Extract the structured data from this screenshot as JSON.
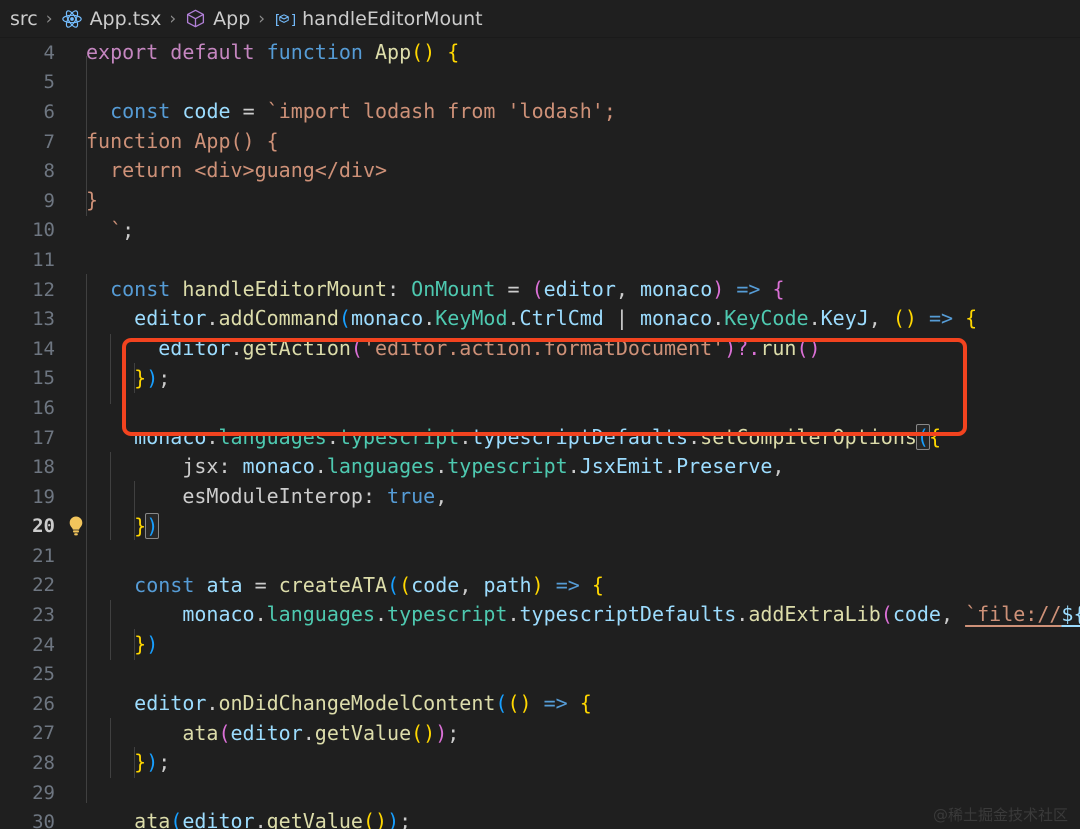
{
  "window": {
    "background": "#1f1f1f",
    "accent_red": "#f2431f"
  },
  "breadcrumb": {
    "items": [
      {
        "label": "src",
        "icon": null
      },
      {
        "label": "App.tsx",
        "icon": "react-atom-icon"
      },
      {
        "label": "App",
        "icon": "symbol-cube-icon"
      },
      {
        "label": "handleEditorMount",
        "icon": "symbol-method-icon"
      }
    ],
    "separator": "›"
  },
  "editor": {
    "active_line": 20,
    "lightbulb_line": 20,
    "lines": [
      {
        "n": 4,
        "text": "export default function App() {"
      },
      {
        "n": 5,
        "text": ""
      },
      {
        "n": 6,
        "text": "  const code = `import lodash from 'lodash';"
      },
      {
        "n": 7,
        "text": "function App() {"
      },
      {
        "n": 8,
        "text": "  return <div>guang</div>"
      },
      {
        "n": 9,
        "text": "}"
      },
      {
        "n": 10,
        "text": "  `;"
      },
      {
        "n": 11,
        "text": ""
      },
      {
        "n": 12,
        "text": "  const handleEditorMount: OnMount = (editor, monaco) => {"
      },
      {
        "n": 13,
        "text": "    editor.addCommand(monaco.KeyMod.CtrlCmd | monaco.KeyCode.KeyJ, () => {"
      },
      {
        "n": 14,
        "text": "      editor.getAction('editor.action.formatDocument')?.run()"
      },
      {
        "n": 15,
        "text": "    });"
      },
      {
        "n": 16,
        "text": ""
      },
      {
        "n": 17,
        "text": "    monaco.languages.typescript.typescriptDefaults.setCompilerOptions({"
      },
      {
        "n": 18,
        "text": "        jsx: monaco.languages.typescript.JsxEmit.Preserve,"
      },
      {
        "n": 19,
        "text": "        esModuleInterop: true,"
      },
      {
        "n": 20,
        "text": "    })"
      },
      {
        "n": 21,
        "text": ""
      },
      {
        "n": 22,
        "text": "    const ata = createATA((code, path) => {"
      },
      {
        "n": 23,
        "text": "        monaco.languages.typescript.typescriptDefaults.addExtraLib(code, `file://${pa"
      },
      {
        "n": 24,
        "text": "    })"
      },
      {
        "n": 25,
        "text": ""
      },
      {
        "n": 26,
        "text": "    editor.onDidChangeModelContent(() => {"
      },
      {
        "n": 27,
        "text": "        ata(editor.getValue());"
      },
      {
        "n": 28,
        "text": "    });"
      },
      {
        "n": 29,
        "text": ""
      },
      {
        "n": 30,
        "text": "    ata(editor.getValue());"
      }
    ],
    "annotation": {
      "type": "red-rectangle-highlight",
      "covers_lines": [
        13,
        14,
        15
      ],
      "color": "#f2431f"
    }
  },
  "watermark": {
    "text": "@稀土掘金技术社区"
  }
}
